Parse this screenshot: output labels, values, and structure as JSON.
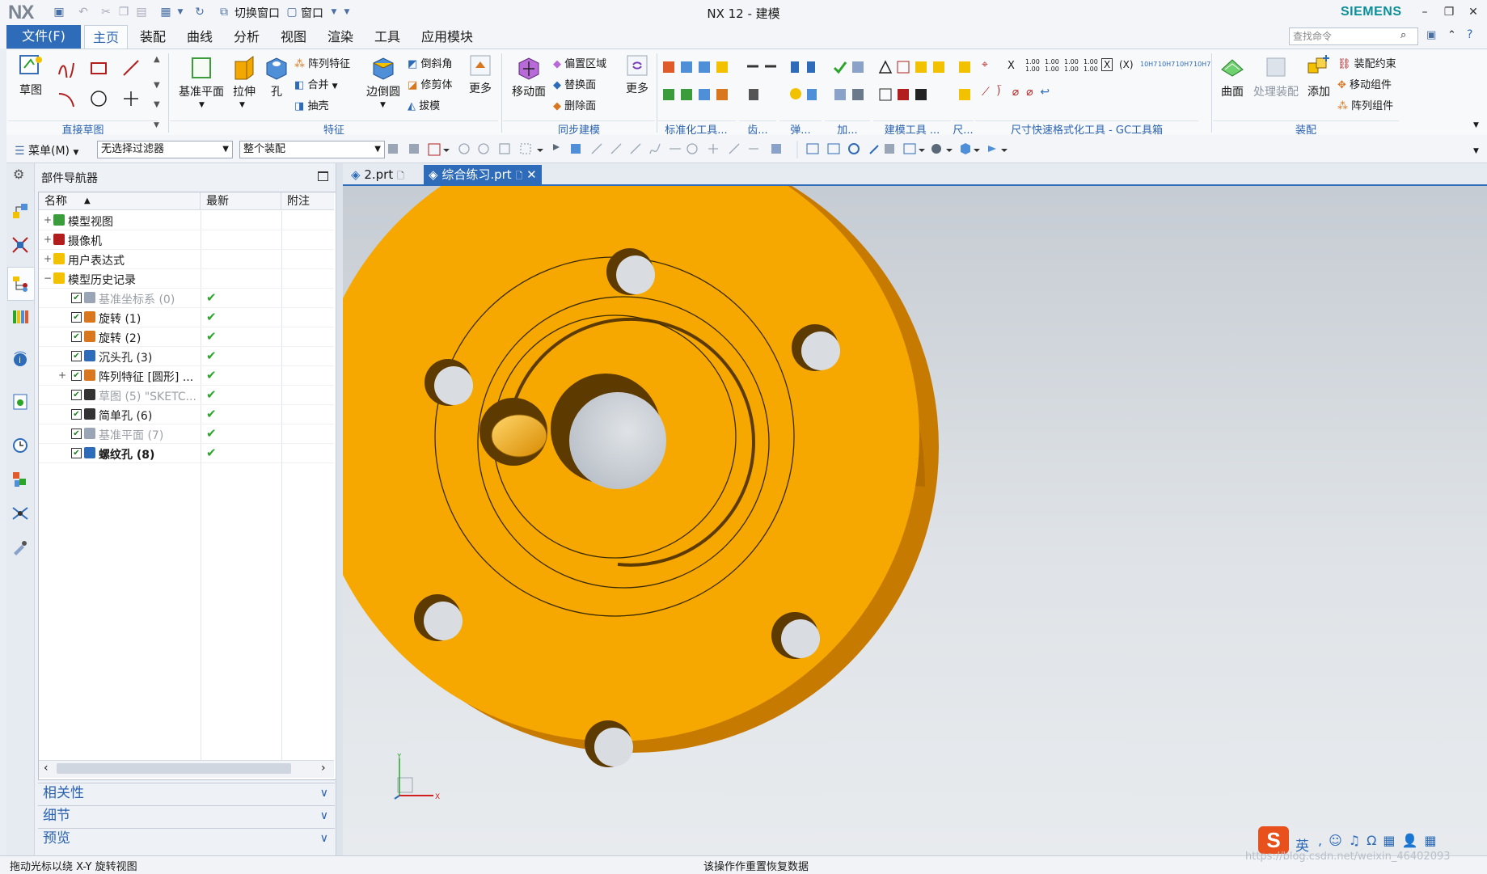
{
  "app": {
    "logo": "NX",
    "title": "NX 12 - 建模",
    "brand": "SIEMENS"
  },
  "quick_access": {
    "switch_window": "切换窗口",
    "window": "窗口"
  },
  "menu": {
    "file": "文件(F)",
    "tabs": [
      "主页",
      "装配",
      "曲线",
      "分析",
      "视图",
      "渲染",
      "工具",
      "应用模块"
    ],
    "active_tab": "主页",
    "search_placeholder": "查找命令"
  },
  "ribbon": {
    "sketch": "草图",
    "datum_plane": "基准平面",
    "extrude": "拉伸",
    "hole": "孔",
    "pattern_feature": "阵列特征",
    "unite": "合并",
    "shell": "抽壳",
    "edge_blend": "边倒圆",
    "chamfer": "倒斜角",
    "trim_body": "修剪体",
    "draft": "拔模",
    "more1": "更多",
    "move_face": "移动面",
    "offset_region": "偏置区域",
    "replace_face": "替换面",
    "delete_face": "删除面",
    "more2": "更多",
    "surface": "曲面",
    "process_assembly": "处理装配",
    "add": "添加",
    "assembly_constraints": "装配约束",
    "move_component": "移动组件",
    "pattern_component": "阵列组件",
    "groups": {
      "direct_sketch": "直接草图",
      "feature": "特征",
      "sync_modeling": "同步建模",
      "standard_tools": "标准化工具...",
      "gear": "齿...",
      "spring": "弹...",
      "machining": "加...",
      "modeling_tools": "建模工具 ...",
      "dim": "尺...",
      "gc_toolkit": "尺寸快速格式化工具 - GC工具箱",
      "assembly": "装配"
    },
    "gc_labels": [
      "X",
      "1.00\n1.00",
      "1.00\n1.00",
      "1.00\n1.00",
      "1.00\n1.00",
      "X",
      "(X)",
      "10H7",
      "10H7",
      "10H7",
      "10H7"
    ]
  },
  "toolbar2": {
    "menu": "菜单(M)",
    "filter": "无选择过滤器",
    "scope": "整个装配"
  },
  "navigator": {
    "title": "部件导航器",
    "columns": [
      "名称",
      "最新",
      "附注"
    ],
    "rows": [
      {
        "label": "模型视图",
        "level": 0,
        "expander": "+",
        "state": "normal"
      },
      {
        "label": "摄像机",
        "level": 0,
        "expander": "+",
        "state": "normal"
      },
      {
        "label": "用户表达式",
        "level": 0,
        "expander": "+",
        "state": "normal"
      },
      {
        "label": "模型历史记录",
        "level": 0,
        "expander": "−",
        "state": "normal"
      },
      {
        "label": "基准坐标系 (0)",
        "level": 1,
        "expander": "",
        "state": "dim",
        "ok": "✔"
      },
      {
        "label": "旋转 (1)",
        "level": 1,
        "expander": "",
        "state": "normal",
        "ok": "✔"
      },
      {
        "label": "旋转 (2)",
        "level": 1,
        "expander": "",
        "state": "normal",
        "ok": "✔"
      },
      {
        "label": "沉头孔 (3)",
        "level": 1,
        "expander": "",
        "state": "normal",
        "ok": "✔"
      },
      {
        "label": "阵列特征 [圆形] ...",
        "level": 1,
        "expander": "+",
        "state": "normal",
        "ok": "✔"
      },
      {
        "label": "草图 (5) \"SKETC...",
        "level": 1,
        "expander": "",
        "state": "dim",
        "ok": "✔"
      },
      {
        "label": "简单孔 (6)",
        "level": 1,
        "expander": "",
        "state": "normal",
        "ok": "✔"
      },
      {
        "label": "基准平面 (7)",
        "level": 1,
        "expander": "",
        "state": "dim",
        "ok": "✔"
      },
      {
        "label": "螺纹孔 (8)",
        "level": 1,
        "expander": "",
        "state": "bold",
        "ok": "✔"
      }
    ],
    "panels": [
      "相关性",
      "细节",
      "预览"
    ]
  },
  "doc_tabs": [
    {
      "label": "2.prt",
      "active": false
    },
    {
      "label": "综合练习.prt",
      "active": true
    }
  ],
  "status": {
    "left": "拖动光标以绕 X-Y 旋转视图",
    "center": "该操作作重置恢复数据",
    "watermark": "https://blog.csdn.net/weixin_46402093"
  },
  "ime": {
    "lang": "英"
  },
  "colors": {
    "part": "#f6a800",
    "accent": "#2e6bb8"
  }
}
